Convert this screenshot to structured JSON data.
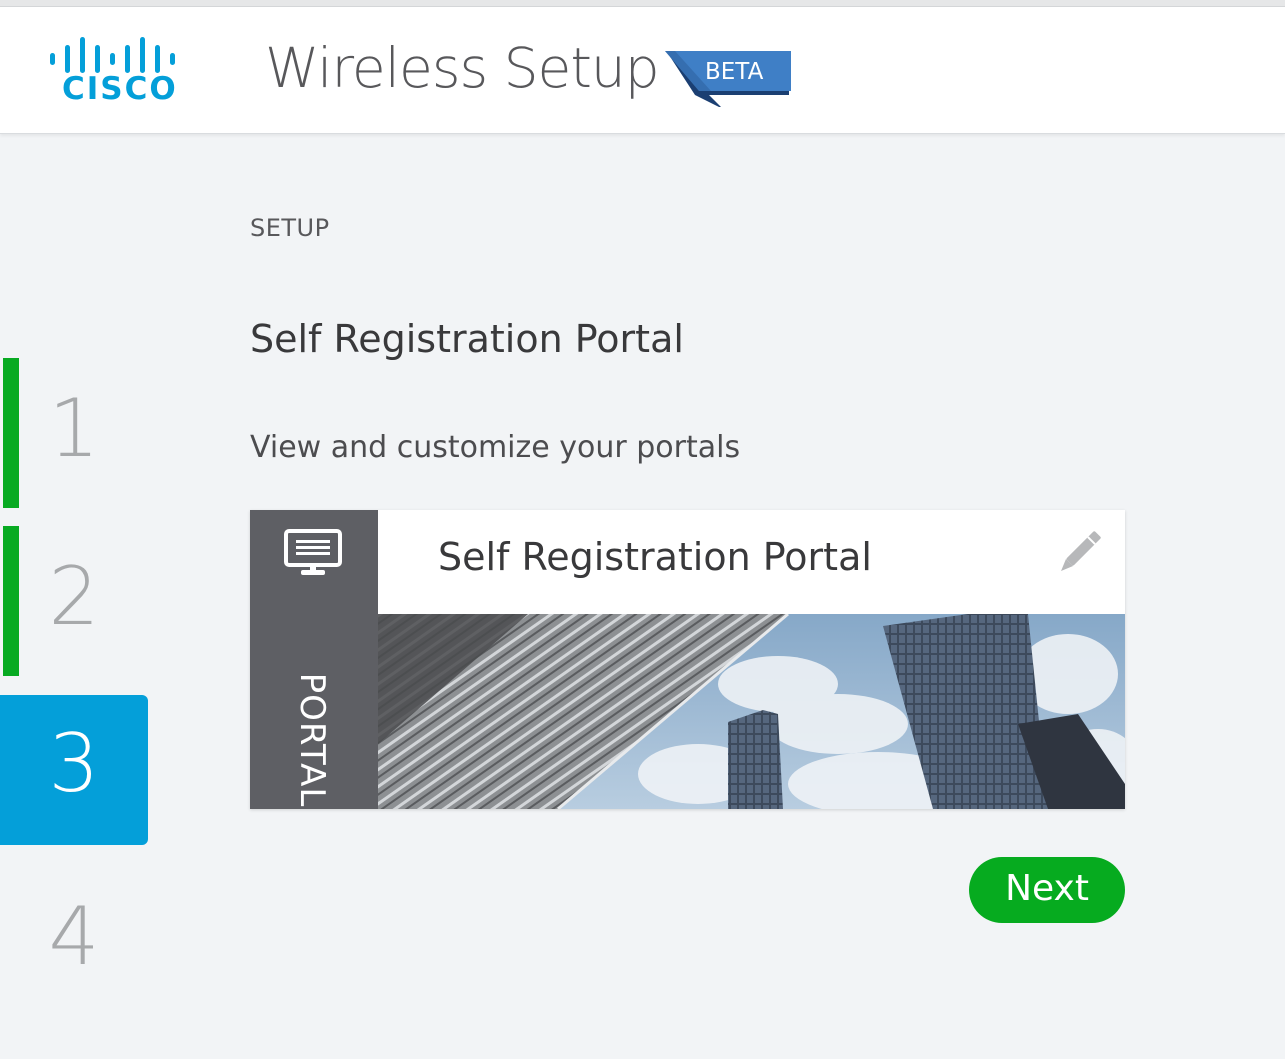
{
  "header": {
    "logo_text": "CISCO",
    "title": "Wireless Setup",
    "badge": "BETA"
  },
  "steps": [
    {
      "label": "1",
      "state": "completed"
    },
    {
      "label": "2",
      "state": "completed"
    },
    {
      "label": "3",
      "state": "active"
    },
    {
      "label": "4",
      "state": "pending"
    }
  ],
  "main": {
    "section_label": "SETUP",
    "page_title": "Self Registration Portal",
    "subtitle": "View and customize your portals"
  },
  "portal_card": {
    "side_label": "PORTAL",
    "title": "Self Registration Portal",
    "side_icon": "monitor-icon",
    "action_icon": "pencil-icon"
  },
  "actions": {
    "next_label": "Next"
  },
  "colors": {
    "brand_blue": "#049fd9",
    "step_complete": "#08aa22",
    "next_button": "#06ab1f",
    "card_sidebar": "#5e5f64"
  }
}
